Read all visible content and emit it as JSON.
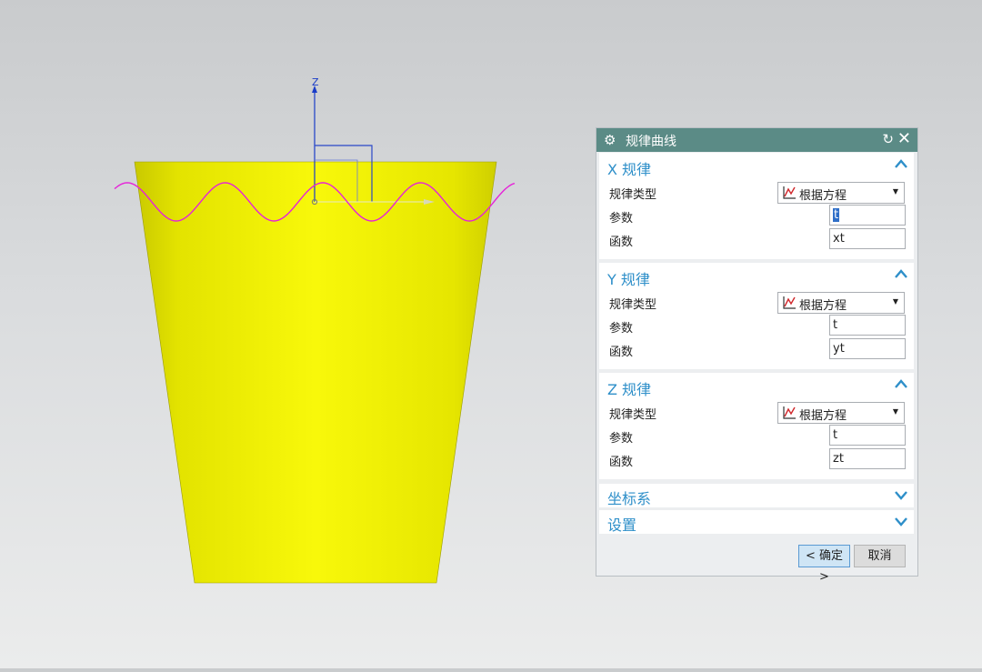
{
  "viewport": {
    "z_axis_label": "Z",
    "colors": {
      "part": "#f2f207",
      "curve": "#e622d8",
      "axis": "#1a3cc8"
    }
  },
  "dialog": {
    "title": "规律曲线",
    "icons": {
      "title": "gear-icon",
      "reset": "reset-icon",
      "close": "close-icon"
    },
    "sections": [
      {
        "title": "X 规律",
        "law_type_label": "规律类型",
        "law_type_value": "根据方程",
        "param_label": "参数",
        "param_value": "t",
        "func_label": "函数",
        "func_value": "xt"
      },
      {
        "title": "Y 规律",
        "law_type_label": "规律类型",
        "law_type_value": "根据方程",
        "param_label": "参数",
        "param_value": "t",
        "func_label": "函数",
        "func_value": "yt"
      },
      {
        "title": "Z 规律",
        "law_type_label": "规律类型",
        "law_type_value": "根据方程",
        "param_label": "参数",
        "param_value": "t",
        "func_label": "函数",
        "func_value": "zt"
      }
    ],
    "collapsed_sections": [
      {
        "title": "坐标系"
      },
      {
        "title": "设置"
      }
    ],
    "ok_label": "< 确定 >",
    "cancel_label": "取消",
    "accent_color": "#2e8fc9",
    "title_bar_color": "#5b8b86"
  }
}
